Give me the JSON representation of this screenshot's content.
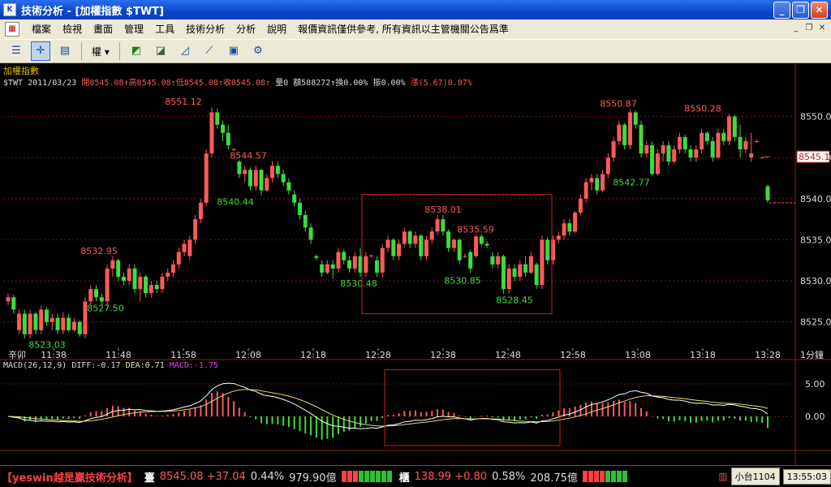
{
  "window": {
    "title": "技術分析 - [加權指數 $TWT]"
  },
  "menu": {
    "items": [
      "檔案",
      "檢視",
      "畫面",
      "管理",
      "工具",
      "技術分析",
      "分析",
      "說明"
    ],
    "notice": "報價資訊僅供參考, 所有資訊以主管機關公告爲準"
  },
  "toolbar": {
    "dropdown_label": "權"
  },
  "quote": {
    "name": "加權指數",
    "symbol": "$TWT",
    "date": "2011/03/23",
    "open": "開8545.08↑",
    "high": "高8545.08↑",
    "low": "低8545.08↑",
    "close": "收8545.08↑",
    "volume": "量0",
    "amount": "額588272↑",
    "turnover": "換0.00%",
    "amplitude": "振0.00%",
    "change": "漲(5.67)0.07%"
  },
  "chart_data": [
    {
      "type": "candlestick",
      "title": "",
      "interval": "1分鐘",
      "ylim": [
        8522,
        8554
      ],
      "y_ticks": [
        "8550.0",
        "8545.0",
        "8540.0",
        "8535.0",
        "8530.0",
        "8525.0"
      ],
      "y_tick_values": [
        8550,
        8545,
        8540,
        8535,
        8530,
        8525
      ],
      "x_tick_labels": [
        "11:38",
        "11:48",
        "11:58",
        "12:08",
        "12:18",
        "12:28",
        "12:38",
        "12:48",
        "12:58",
        "13:08",
        "13:18",
        "13:28"
      ],
      "x_start_label": "辛卯",
      "current_price_label": "8545.1",
      "annotations": [
        {
          "text": "8551.12",
          "x": "11:58",
          "y": 8551.12
        },
        {
          "text": "8544.57",
          "x": "12:08",
          "y": 8544.57
        },
        {
          "text": "8540.44",
          "x": "12:06",
          "y": 8540.44
        },
        {
          "text": "8532.95",
          "x": "11:45",
          "y": 8532.95
        },
        {
          "text": "8527.50",
          "x": "11:46",
          "y": 8527.5
        },
        {
          "text": "8523.03",
          "x": "11:37",
          "y": 8523.03
        },
        {
          "text": "8538.01",
          "x": "12:38",
          "y": 8538.01
        },
        {
          "text": "8535.59",
          "x": "12:43",
          "y": 8535.59
        },
        {
          "text": "8530.48",
          "x": "12:25",
          "y": 8530.48
        },
        {
          "text": "8530.85",
          "x": "12:41",
          "y": 8530.85
        },
        {
          "text": "8528.45",
          "x": "12:49",
          "y": 8528.45
        },
        {
          "text": "8550.87",
          "x": "13:05",
          "y": 8550.87
        },
        {
          "text": "8550.28",
          "x": "13:18",
          "y": 8550.28
        },
        {
          "text": "8542.77",
          "x": "13:07",
          "y": 8542.77
        }
      ],
      "highlight_box": {
        "x_from": "12:28",
        "x_to": "12:56",
        "y_from": 8526,
        "y_to": 8540.5
      },
      "candles": [
        [
          8527.5,
          8528.5,
          8527,
          8528
        ],
        [
          8528,
          8528.3,
          8526,
          8526.5
        ],
        [
          8524,
          8526.5,
          8523.5,
          8526
        ],
        [
          8526,
          8526.5,
          8523,
          8523.5
        ],
        [
          8523.5,
          8526.5,
          8523,
          8526
        ],
        [
          8526,
          8526.2,
          8523.5,
          8524
        ],
        [
          8524,
          8527,
          8523.5,
          8526.5
        ],
        [
          8526.5,
          8526.8,
          8524.5,
          8525
        ],
        [
          8525,
          8526,
          8524,
          8525.5
        ],
        [
          8525.5,
          8526,
          8523.5,
          8524
        ],
        [
          8524,
          8526.2,
          8523.5,
          8525.5
        ],
        [
          8525.5,
          8526,
          8523.8,
          8524
        ],
        [
          8524,
          8525.5,
          8523.8,
          8525
        ],
        [
          8525,
          8525.2,
          8523.2,
          8523.5
        ],
        [
          8523.5,
          8528,
          8523,
          8527.5
        ],
        [
          8527.5,
          8529.5,
          8527,
          8529
        ],
        [
          8529,
          8529.5,
          8527.5,
          8528
        ],
        [
          8528,
          8528.5,
          8527,
          8527.5
        ],
        [
          8527.5,
          8532,
          8527,
          8531.5
        ],
        [
          8531.5,
          8533,
          8530.5,
          8532.5
        ],
        [
          8532.5,
          8532.7,
          8530,
          8530.5
        ],
        [
          8530.5,
          8531,
          8529.5,
          8530
        ],
        [
          8530,
          8532,
          8529.5,
          8531.5
        ],
        [
          8531.5,
          8532,
          8528.5,
          8529
        ],
        [
          8529,
          8531,
          8527.5,
          8530.5
        ],
        [
          8530.5,
          8530.7,
          8528,
          8528.5
        ],
        [
          8528.5,
          8530,
          8528,
          8529.5
        ],
        [
          8529.5,
          8530,
          8528.5,
          8529
        ],
        [
          8529,
          8531,
          8528.5,
          8530.5
        ],
        [
          8530.5,
          8531.5,
          8530,
          8531
        ],
        [
          8531,
          8532.5,
          8530.5,
          8532
        ],
        [
          8532,
          8534,
          8531.5,
          8533.5
        ],
        [
          8533.5,
          8535,
          8533,
          8534.5
        ],
        [
          8533,
          8535.5,
          8532.5,
          8535
        ],
        [
          8535,
          8538,
          8534.5,
          8537.5
        ],
        [
          8537.5,
          8540,
          8537,
          8539.5
        ],
        [
          8539.5,
          8546,
          8539,
          8545.5
        ],
        [
          8545.5,
          8551.1,
          8545,
          8550.5
        ],
        [
          8550.5,
          8551,
          8548.5,
          8549
        ],
        [
          8549,
          8549.5,
          8547,
          8548
        ],
        [
          8548,
          8549,
          8546,
          8546.5
        ],
        [
          8546,
          8546.2,
          8545.8,
          8546
        ],
        [
          8544.5,
          8544.7,
          8542.5,
          8543
        ],
        [
          8543,
          8544,
          8542,
          8543.5
        ],
        [
          8543.5,
          8543.8,
          8541,
          8541.5
        ],
        [
          8541.5,
          8544,
          8541,
          8543.5
        ],
        [
          8543.5,
          8543.6,
          8540.4,
          8541
        ],
        [
          8541,
          8543,
          8540.8,
          8542.5
        ],
        [
          8542.5,
          8544.6,
          8542,
          8544
        ],
        [
          8544,
          8544.5,
          8542.5,
          8543
        ],
        [
          8543,
          8543.5,
          8541.5,
          8542
        ],
        [
          8542,
          8542.5,
          8540.5,
          8541
        ],
        [
          8540.5,
          8541,
          8539,
          8539.5
        ],
        [
          8539.5,
          8540,
          8537.5,
          8538
        ],
        [
          8538,
          8538.5,
          8536,
          8536.5
        ],
        [
          8536.5,
          8537,
          8534.5,
          8535
        ],
        [
          8533,
          8533.2,
          8532.5,
          8532.8
        ],
        [
          8532,
          8532.5,
          8530.5,
          8531
        ],
        [
          8531,
          8532.5,
          8530.8,
          8532
        ],
        [
          8532,
          8532.5,
          8530.3,
          8531.5
        ],
        [
          8531.5,
          8534,
          8531,
          8533.5
        ],
        [
          8533.5,
          8533.8,
          8532,
          8532.5
        ],
        [
          8532.5,
          8533,
          8531,
          8531.5
        ],
        [
          8531.5,
          8533.5,
          8531,
          8533
        ],
        [
          8533,
          8534,
          8530.5,
          8531
        ],
        [
          8531,
          8533.5,
          8530.5,
          8533
        ],
        [
          8533,
          8533.2,
          8532.8,
          8533.1
        ],
        [
          8532.5,
          8533,
          8530.5,
          8531
        ],
        [
          8531,
          8534.5,
          8530.5,
          8534
        ],
        [
          8534,
          8535.5,
          8533.5,
          8535
        ],
        [
          8535,
          8535.2,
          8532.5,
          8533
        ],
        [
          8533,
          8535,
          8532.5,
          8534.5
        ],
        [
          8534.5,
          8536.5,
          8534,
          8536
        ],
        [
          8536,
          8536.2,
          8534,
          8534.5
        ],
        [
          8534.5,
          8536,
          8534,
          8535.5
        ],
        [
          8535.5,
          8535.7,
          8532.5,
          8533
        ],
        [
          8533,
          8535.5,
          8532.5,
          8535
        ],
        [
          8535,
          8536.5,
          8534.5,
          8536
        ],
        [
          8536,
          8538,
          8535.5,
          8537.5
        ],
        [
          8537.5,
          8538,
          8535.5,
          8536
        ],
        [
          8536,
          8536.3,
          8533.5,
          8534
        ],
        [
          8534,
          8535.2,
          8533.5,
          8535
        ],
        [
          8535,
          8535.2,
          8532,
          8532.5
        ],
        [
          8533,
          8533.3,
          8532.8,
          8533
        ],
        [
          8533.5,
          8533.8,
          8531,
          8531.5
        ],
        [
          8533,
          8535.6,
          8532.8,
          8535.4
        ],
        [
          8535.4,
          8535.7,
          8534.2,
          8534.5
        ],
        [
          8534.5,
          8534.8,
          8534,
          8534.3
        ],
        [
          8533,
          8533.5,
          8531.5,
          8532
        ],
        [
          8532,
          8533.5,
          8531.5,
          8533
        ],
        [
          8533,
          8533.2,
          8528.4,
          8529
        ],
        [
          8529,
          8532,
          8528.5,
          8531.5
        ],
        [
          8531.5,
          8532,
          8530,
          8530.5
        ],
        [
          8530.5,
          8532.5,
          8530,
          8532
        ],
        [
          8532,
          8533,
          8530.5,
          8531
        ],
        [
          8531,
          8533.5,
          8530.8,
          8533
        ],
        [
          8532,
          8532.2,
          8529,
          8529.5
        ],
        [
          8529.5,
          8535.5,
          8529,
          8535
        ],
        [
          8535,
          8535.3,
          8532,
          8532.5
        ],
        [
          8532.5,
          8535.5,
          8532,
          8535
        ],
        [
          8535,
          8536,
          8534.5,
          8535.5
        ],
        [
          8535.5,
          8537.5,
          8535,
          8537
        ],
        [
          8537,
          8537.5,
          8535.5,
          8536
        ],
        [
          8536,
          8538.5,
          8535.8,
          8538.3
        ],
        [
          8538.3,
          8540.5,
          8538,
          8540
        ],
        [
          8540,
          8542.5,
          8539.5,
          8542
        ],
        [
          8542,
          8543,
          8541,
          8542.5
        ],
        [
          8542.5,
          8543,
          8540.5,
          8541
        ],
        [
          8541,
          8543.5,
          8540.8,
          8543
        ],
        [
          8543,
          8545.5,
          8542.5,
          8545
        ],
        [
          8545,
          8547.5,
          8544.5,
          8547
        ],
        [
          8547,
          8549.5,
          8546.5,
          8549
        ],
        [
          8549,
          8549.2,
          8546,
          8546.5
        ],
        [
          8546.5,
          8550.9,
          8546,
          8550.5
        ],
        [
          8550.5,
          8550.7,
          8548.5,
          8549
        ],
        [
          8549,
          8549.5,
          8545,
          8545.5
        ],
        [
          8545.5,
          8547,
          8545,
          8546.5
        ],
        [
          8546.5,
          8547,
          8542.8,
          8543
        ],
        [
          8543,
          8546,
          8542.8,
          8545.5
        ],
        [
          8545.5,
          8547,
          8544.5,
          8546.5
        ],
        [
          8546.5,
          8547,
          8544,
          8544.5
        ],
        [
          8544.5,
          8546.5,
          8544.2,
          8546
        ],
        [
          8546,
          8548,
          8545.5,
          8547.5
        ],
        [
          8547.5,
          8547.8,
          8545.5,
          8546
        ],
        [
          8546,
          8546.5,
          8544.5,
          8545
        ],
        [
          8545,
          8546.5,
          8544.5,
          8546
        ],
        [
          8546,
          8548.5,
          8545.5,
          8548
        ],
        [
          8548,
          8548.2,
          8546.5,
          8547
        ],
        [
          8547,
          8547.5,
          8544.5,
          8545
        ],
        [
          8545,
          8548.5,
          8544.8,
          8548
        ],
        [
          8548,
          8548.5,
          8546.5,
          8547
        ],
        [
          8547,
          8550.3,
          8546.5,
          8550
        ],
        [
          8550,
          8550.2,
          8547,
          8547.5
        ],
        [
          8547.5,
          8549,
          8545,
          8546
        ],
        [
          8546,
          8547.5,
          8545.5,
          8547
        ],
        [
          8545,
          8548,
          8544.5,
          8545.5
        ],
        [
          8547,
          8547.2,
          8546.8,
          8547
        ],
        [
          8545,
          8545.1,
          8544.9,
          8545
        ],
        [
          8541.5,
          8541.7,
          8539.5,
          8539.8
        ]
      ]
    },
    {
      "type": "line+bar",
      "title": "MACD(26,12,9)",
      "diff_label": "DIFF:-0.17",
      "dea_label": "DEA:0.71",
      "macd_label": "MACD:-1.75",
      "ylim": [
        -5,
        8.5
      ],
      "y_ticks": [
        "5.00",
        "0.00"
      ],
      "y_tick_values": [
        5,
        0
      ]
    }
  ],
  "statusbar": {
    "brand": "【yeswin越是贏技術分析】",
    "index1_label": "臺",
    "index1_value": "8545.08 +37.04",
    "index1_pct": "0.44%",
    "index1_amount": "979.90億",
    "index2_label": "櫃",
    "index2_value": "138.99 +0.80",
    "index2_pct": "0.58%",
    "index2_amount": "208.75億",
    "tray_label": "小台1104",
    "clock": "13:55:03"
  },
  "colors": {
    "up": "#ff5a5a",
    "down": "#3ddc3d",
    "grid": "#6a1818",
    "box": "#d02020",
    "yellow": "#e0c000",
    "magenta": "#e040e0"
  }
}
